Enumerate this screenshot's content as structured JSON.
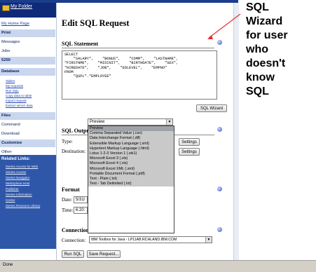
{
  "sidebar": {
    "folder_title": "My Folder",
    "items": [
      {
        "label": "My Home Page",
        "kind": "link"
      },
      {
        "label": "Print",
        "kind": "header"
      },
      {
        "label": "Messages",
        "kind": "row"
      },
      {
        "label": "Jobs",
        "kind": "row"
      },
      {
        "label": "5250",
        "kind": "header"
      },
      {
        "label": "Database",
        "kind": "row"
      }
    ],
    "database_links": [
      "Tables",
      "My requests",
      "Run SQL",
      "Copy data to table",
      "Import request",
      "Extract server data"
    ],
    "lower_items": [
      {
        "label": "Files",
        "kind": "header"
      },
      {
        "label": "Command",
        "kind": "row"
      },
      {
        "label": "Download",
        "kind": "row"
      },
      {
        "label": "Customize",
        "kind": "header"
      },
      {
        "label": "Other",
        "kind": "row"
      }
    ],
    "related": {
      "heading": "Related Links:",
      "links": [
        "iSeries Access for Web",
        "iSeries Access",
        "iSeries Navigator",
        "WebSphere Host",
        "Publisher",
        "iSeries Information",
        "Center",
        "iSeries Resource Library"
      ]
    }
  },
  "main": {
    "title": "Edit SQL Request",
    "sql_statement_heading": "SQL Statement",
    "sql_text": "SELECT\n    \"SALARY\",    \"BONUS\",    \"COMM\",    \"LASTNAME\",\n\"FIRSTNME\",    \"MIDINIT\",    \"BIRTHDATE\",    \"SEX\",\n\"HIREDATE\",    \"JOB\",    \"EDLEVEL\",    \"EMPNO\"\nFROM\n    \"QSPL\".\"EMPLOYEE\"",
    "sql_wizard_button": "SQL Wizard",
    "sql_output_heading": "SQL Output",
    "type_label": "Type:",
    "type_value": "Preview",
    "destination_label": "Destination:",
    "settings_button": "Settings",
    "settings_button_2": "Settings",
    "type_options": [
      "Preview",
      "Comma Separated Value (.csv)",
      "Data Interchange Format (.dif)",
      "Extensible Markup Language (.xml)",
      "Hypertext Markup Language (.html)",
      "Lotus 1-2-3 Version 1 (.wk1)",
      "Microsoft Excel 3 (.xls)",
      "Microsoft Excel 4 (.xls)",
      "Microsoft Excel XML (.xml)",
      "Portable Document Format (.pdf)",
      "Text - Plain (.txt)",
      "Text - Tab Delimited (.txt)"
    ],
    "format_heading": "Format",
    "date_label": "Date:",
    "date_value": "5/31/",
    "time_label": "Time:",
    "time_value": "6:20:",
    "connection_heading": "Connection",
    "connection_label": "Connection:",
    "connection_value": "IBM Toolbox for Java - LP11AB.RCHLAND.IBM.COM",
    "run_sql_button": "Run SQL",
    "save_request_button": "Save Request..."
  },
  "callout": {
    "lines": [
      "SQL",
      "Wizard",
      "for user",
      "who",
      "doesn't",
      "know",
      "SQL"
    ]
  },
  "status": {
    "text": "Done"
  }
}
